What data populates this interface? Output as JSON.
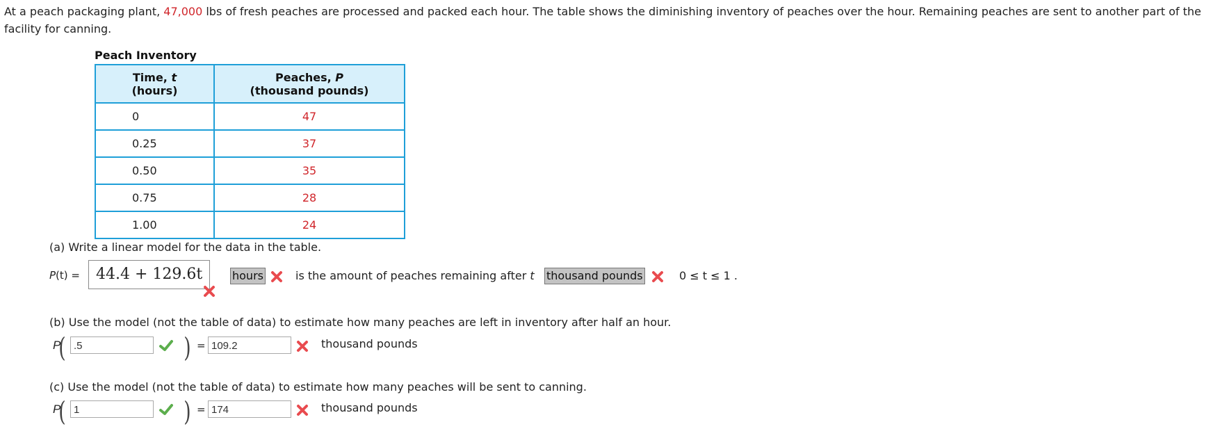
{
  "intro": {
    "before": "At a peach packaging plant, ",
    "highlight": "47,000",
    "after": " lbs of fresh peaches are processed and packed each hour. The table shows the diminishing inventory of peaches over the hour. Remaining peaches are sent to another part of the facility for canning."
  },
  "table": {
    "caption": "Peach Inventory",
    "headers": [
      {
        "line1": "Time, ",
        "var": "t",
        "line2": "(hours)"
      },
      {
        "line1": "Peaches, ",
        "var": "P",
        "line2": "(thousand pounds)"
      }
    ],
    "rows": [
      {
        "t": "0",
        "p": "47"
      },
      {
        "t": "0.25",
        "p": "37"
      },
      {
        "t": "0.50",
        "p": "35"
      },
      {
        "t": "0.75",
        "p": "28"
      },
      {
        "t": "1.00",
        "p": "24"
      }
    ]
  },
  "part_a": {
    "question": "(a) Write a linear model for the data in the table.",
    "lhs_fn": "P",
    "lhs_arg": "(t) =",
    "answer": "44.4 + 129.6t",
    "answer_status": "incorrect",
    "dropdown1_value": "hours",
    "dropdown1_status": "incorrect",
    "middle_text": "is the amount of peaches remaining after ",
    "middle_var": "t",
    "dropdown2_value": "thousand pounds",
    "dropdown2_status": "incorrect",
    "domain": "0 ≤ t ≤ 1 ."
  },
  "part_b": {
    "question": "(b) Use the model (not the table of data) to estimate how many peaches are left in inventory after half an hour.",
    "fn": "P",
    "input_value": ".5",
    "input_status": "correct",
    "equals": "=",
    "result_value": "109.2",
    "result_status": "incorrect",
    "units": "thousand pounds"
  },
  "part_c": {
    "question": "(c) Use the model (not the table of data) to estimate how many peaches will be sent to canning.",
    "fn": "P",
    "input_value": "1",
    "input_status": "correct",
    "equals": "=",
    "result_value": "174",
    "result_status": "incorrect",
    "units": "thousand pounds"
  },
  "colors": {
    "highlight_red": "#d0262b",
    "table_border": "#1e9fd8",
    "table_header_bg": "#d7f0fb",
    "incorrect_icon": "#e94b4f",
    "correct_icon": "#5cae4d"
  }
}
